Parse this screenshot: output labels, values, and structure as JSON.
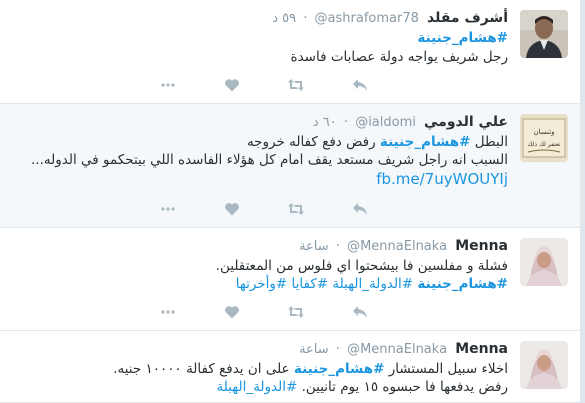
{
  "tweets": [
    {
      "name": "أشرف مقلد",
      "handle": "@ashrafomar78",
      "time": "٥٩ د",
      "hashtag": "#هشام_جنينة",
      "text": "رجل شريف يواجه دولة عصابات فاسدة"
    },
    {
      "name": "علي الدومي",
      "handle": "@ialdomi",
      "time": "٦٠ د",
      "line1_pre": "البطل ",
      "hashtag": "#هشام_جنينة",
      "line1_post": " رفض دفع كفاله خروجه",
      "line2": "السبب انه راجل شريف مستعد يقف امام كل هؤلاء الفاسده اللي بيتحكمو في الدوله...",
      "link": "fb.me/7uyWOUYIj"
    },
    {
      "name": "Menna",
      "handle": "@MennaElnaka",
      "time": "ساعة",
      "line1": "فشلة و مفلسين فا بيشحتوا اي فلوس من المعتقلين.",
      "tags": [
        "#هشام_جنينة",
        "#الدولة_الهبلة",
        "#كفايا",
        "#وأخرتها"
      ]
    },
    {
      "name": "Menna",
      "handle": "@MennaElnaka",
      "time": "ساعة",
      "line1_pre": "اخلاء سبيل المستشار ",
      "hashtag": "#هشام_جنينة",
      "line1_post": " على ان يدفع كفالة ١٠٠٠٠ جنيه.",
      "line2": "رفض يدفعها فا حبسوه ١٥ يوم تانيين.",
      "tag2": "#الدولة_الهبلة"
    }
  ],
  "actions": {
    "reply_icon": "reply-icon",
    "retweet_icon": "retweet-icon",
    "like_icon": "heart-icon",
    "more_icon": "more-dots-icon"
  },
  "colors": {
    "link": "#1b95e0",
    "muted": "#8899a6",
    "icon": "#aab8c2",
    "text": "#292f33"
  }
}
